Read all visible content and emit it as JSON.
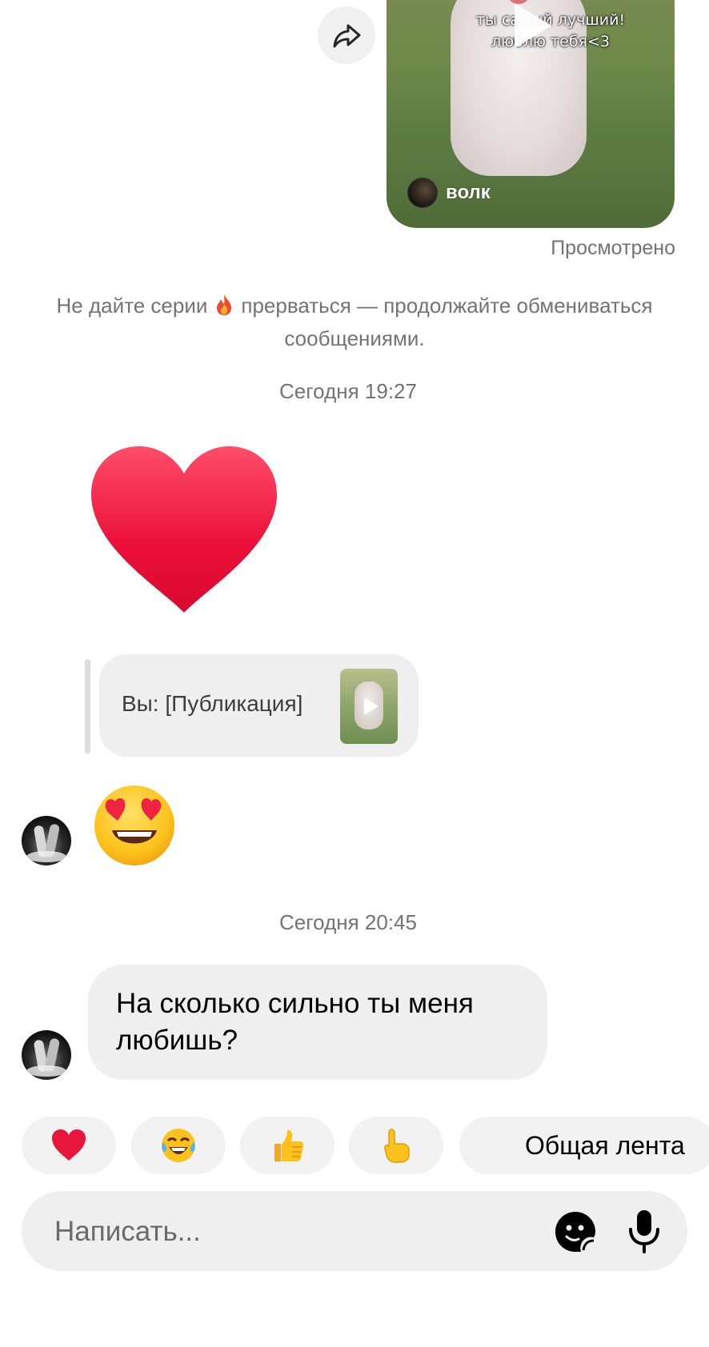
{
  "shared_reel": {
    "caption": "ты самый лучший!\nлюблю тебя<3",
    "author": "волк",
    "status": "Просмотрено"
  },
  "streak_notice": {
    "text_before": "Не дайте серии",
    "text_after": "прерваться — продолжайте обмениваться сообщениями."
  },
  "timestamps": [
    "Сегодня 19:27",
    "Сегодня 20:45"
  ],
  "reply": {
    "label": "Вы: [Публикация]"
  },
  "incoming_message": {
    "text": "На сколько сильно ты меня любишь?"
  },
  "quick_reactions": [
    "heart",
    "face-with-tears-of-joy",
    "thumbs-up",
    "pointing-hand"
  ],
  "feed_button": "Общая лента",
  "composer": {
    "placeholder": "Написать..."
  },
  "colors": {
    "bubble": "#efefef",
    "secondary_text": "#737373",
    "heart": "#e8163a"
  }
}
